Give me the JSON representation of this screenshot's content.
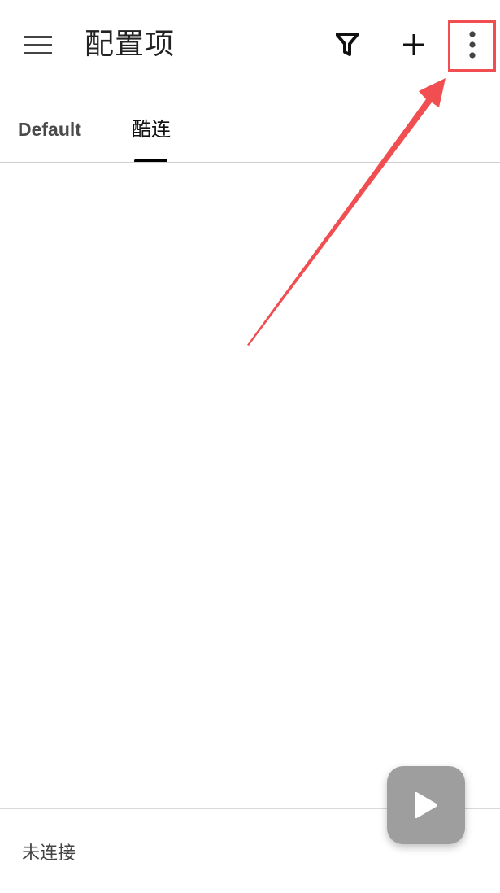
{
  "appbar": {
    "title": "配置项",
    "menu_icon": "menu-icon",
    "filter_icon": "filter-icon",
    "add_icon": "add-icon",
    "more_icon": "more-vert-icon"
  },
  "tabs": [
    {
      "label": "Default",
      "active": false
    },
    {
      "label": "酷连",
      "active": true
    }
  ],
  "fab": {
    "icon": "play-icon"
  },
  "status": {
    "text": "未连接"
  },
  "colors": {
    "annotation": "#f04e50",
    "fab": "#9e9e9e",
    "tab_indicator": "#000000"
  }
}
